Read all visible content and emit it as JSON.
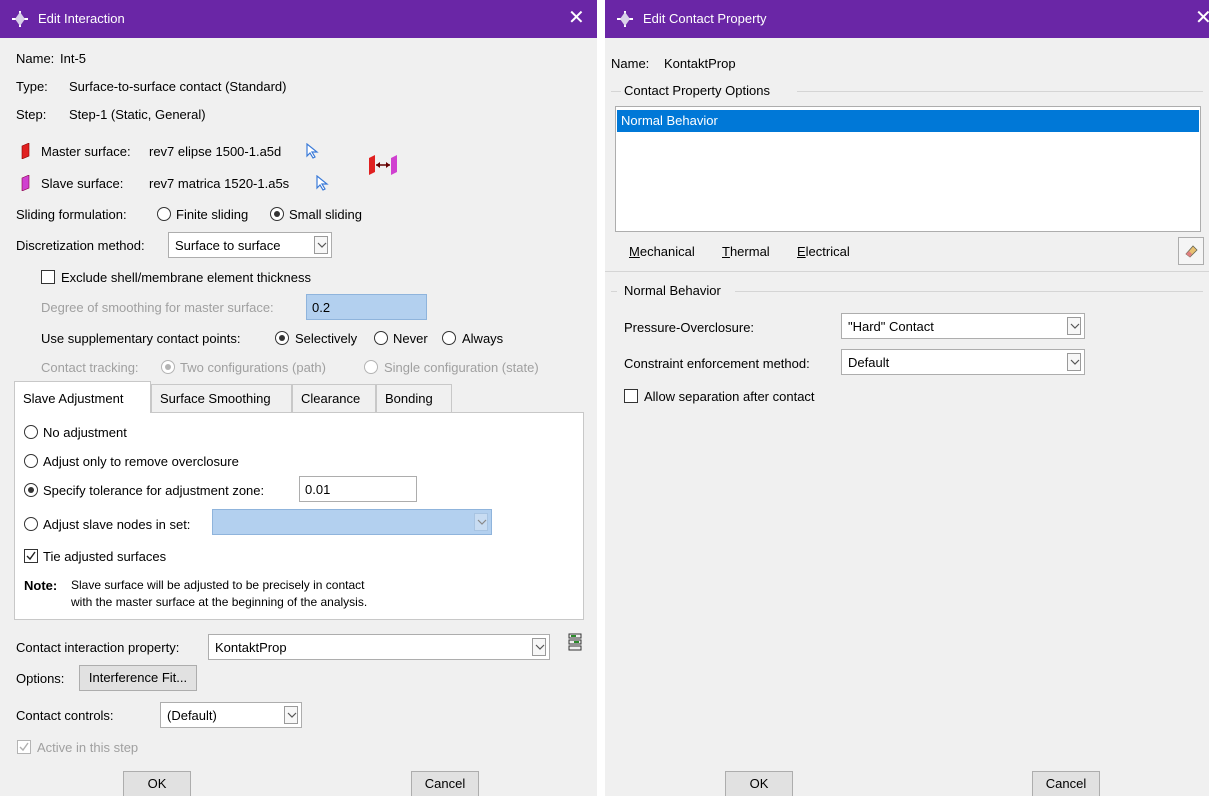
{
  "left": {
    "title": "Edit Interaction",
    "name_label": "Name:",
    "name_value": "Int-5",
    "type_label": "Type:",
    "type_value": "Surface-to-surface contact (Standard)",
    "step_label": "Step:",
    "step_value": "Step-1 (Static, General)",
    "master_label": "Master surface:",
    "master_value": "rev7 elipse 1500-1.a5d",
    "slave_label": "Slave surface:",
    "slave_value": "rev7 matrica 1520-1.a5s",
    "sliding_label": "Sliding formulation:",
    "sliding_finite": "Finite sliding",
    "sliding_small": "Small sliding",
    "discretization_label": "Discretization method:",
    "discretization_value": "Surface to surface",
    "exclude_shell": "Exclude shell/membrane element thickness",
    "smoothing_label": "Degree of smoothing for master surface:",
    "smoothing_value": "0.2",
    "supp_label": "Use supplementary contact points:",
    "supp_selectively": "Selectively",
    "supp_never": "Never",
    "supp_always": "Always",
    "tracking_label": "Contact tracking:",
    "tracking_two": "Two configurations (path)",
    "tracking_single": "Single configuration (state)",
    "tabs": [
      "Slave Adjustment",
      "Surface Smoothing",
      "Clearance",
      "Bonding"
    ],
    "adj_none": "No adjustment",
    "adj_overclosure": "Adjust only to remove overclosure",
    "adj_tolerance": "Specify tolerance for adjustment zone:",
    "adj_tolerance_value": "0.01",
    "adj_nodes": "Adjust slave nodes in set:",
    "tie": "Tie adjusted surfaces",
    "note_label": "Note:",
    "note_line1": "Slave surface will be adjusted to be precisely in contact",
    "note_line2": "with the master surface at the beginning of the analysis.",
    "cip_label": "Contact interaction property:",
    "cip_value": "KontaktProp",
    "options_label": "Options:",
    "interference_btn": "Interference Fit...",
    "controls_label": "Contact controls:",
    "controls_value": "(Default)",
    "active_label": "Active in this step",
    "ok": "OK",
    "cancel": "Cancel"
  },
  "right": {
    "title": "Edit Contact Property",
    "name_label": "Name:",
    "name_value": "KontaktProp",
    "options_group": "Contact Property Options",
    "options_list": [
      "Normal Behavior"
    ],
    "menu": [
      "Mechanical",
      "Thermal",
      "Electrical"
    ],
    "section_title": "Normal Behavior",
    "pressure_label": "Pressure-Overclosure:",
    "pressure_value": "\"Hard\" Contact",
    "constraint_label": "Constraint enforcement method:",
    "constraint_value": "Default",
    "allow_sep": "Allow separation after contact",
    "ok": "OK",
    "cancel": "Cancel"
  },
  "colors": {
    "titlebar": "#6a26a6",
    "selection": "#0078d7",
    "field_highlight": "#b3d0ef"
  }
}
